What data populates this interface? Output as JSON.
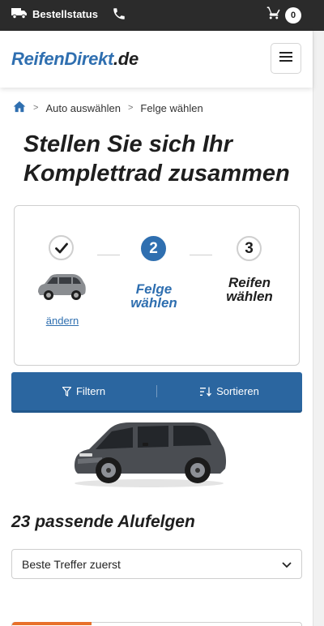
{
  "topbar": {
    "order_status_label": "Bestellstatus",
    "cart_count": "0"
  },
  "header": {
    "logo_part1": "ReifenDirekt",
    "logo_part2": ".de"
  },
  "breadcrumb": {
    "items": [
      "Auto auswählen",
      "Felge wählen"
    ],
    "separator": ">"
  },
  "page_title": "Stellen Sie sich Ihr Komplettrad zusammen",
  "steps": {
    "step1_change_link": "ändern",
    "step2_number": "2",
    "step2_label_line1": "Felge",
    "step2_label_line2": "wählen",
    "step3_number": "3",
    "step3_label_line1": "Reifen",
    "step3_label_line2": "wählen"
  },
  "filterbar": {
    "filter_label": "Filtern",
    "sort_label": "Sortieren"
  },
  "results_heading": "23 passende Alufelgen",
  "sort_select": {
    "selected": "Beste Treffer zuerst"
  },
  "colors": {
    "brand_blue": "#2f6fb0",
    "topbar_bg": "#2b2b2b",
    "filterbar_bg": "#2b66a0",
    "accent_orange": "#e8712b"
  }
}
